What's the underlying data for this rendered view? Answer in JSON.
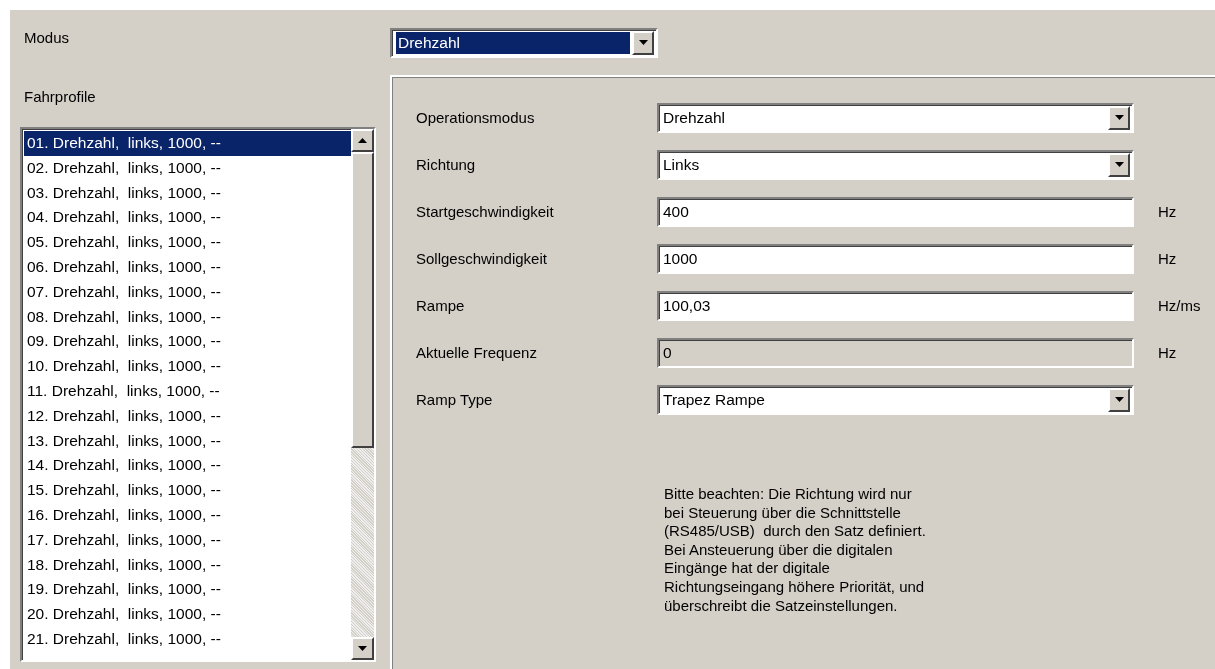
{
  "modus": {
    "label": "Modus",
    "value": "Drehzahl",
    "selected": true
  },
  "profiles": {
    "label": "Fahrprofile",
    "items": [
      {
        "text": "01. Drehzahl,  links, 1000, --",
        "selected": true
      },
      {
        "text": "02. Drehzahl,  links, 1000, --",
        "selected": false
      },
      {
        "text": "03. Drehzahl,  links, 1000, --",
        "selected": false
      },
      {
        "text": "04. Drehzahl,  links, 1000, --",
        "selected": false
      },
      {
        "text": "05. Drehzahl,  links, 1000, --",
        "selected": false
      },
      {
        "text": "06. Drehzahl,  links, 1000, --",
        "selected": false
      },
      {
        "text": "07. Drehzahl,  links, 1000, --",
        "selected": false
      },
      {
        "text": "08. Drehzahl,  links, 1000, --",
        "selected": false
      },
      {
        "text": "09. Drehzahl,  links, 1000, --",
        "selected": false
      },
      {
        "text": "10. Drehzahl,  links, 1000, --",
        "selected": false
      },
      {
        "text": "11. Drehzahl,  links, 1000, --",
        "selected": false
      },
      {
        "text": "12. Drehzahl,  links, 1000, --",
        "selected": false
      },
      {
        "text": "13. Drehzahl,  links, 1000, --",
        "selected": false
      },
      {
        "text": "14. Drehzahl,  links, 1000, --",
        "selected": false
      },
      {
        "text": "15. Drehzahl,  links, 1000, --",
        "selected": false
      },
      {
        "text": "16. Drehzahl,  links, 1000, --",
        "selected": false
      },
      {
        "text": "17. Drehzahl,  links, 1000, --",
        "selected": false
      },
      {
        "text": "18. Drehzahl,  links, 1000, --",
        "selected": false
      },
      {
        "text": "19. Drehzahl,  links, 1000, --",
        "selected": false
      },
      {
        "text": "20. Drehzahl,  links, 1000, --",
        "selected": false
      },
      {
        "text": "21. Drehzahl,  links, 1000, --",
        "selected": false
      }
    ]
  },
  "fields": [
    {
      "kind": "select",
      "label": "Operationsmodus",
      "value": "Drehzahl"
    },
    {
      "kind": "select",
      "label": "Richtung",
      "value": "Links"
    },
    {
      "kind": "text",
      "label": "Startgeschwindigkeit",
      "value": "400",
      "unit": "Hz",
      "disabled": false
    },
    {
      "kind": "text",
      "label": "Sollgeschwindigkeit",
      "value": "1000",
      "unit": "Hz",
      "disabled": false
    },
    {
      "kind": "text",
      "label": "Rampe",
      "value": "100,03",
      "unit": "Hz/ms",
      "disabled": false
    },
    {
      "kind": "text",
      "label": "Aktuelle Frequenz",
      "value": "0",
      "unit": "Hz",
      "disabled": true
    },
    {
      "kind": "select",
      "label": "Ramp Type",
      "value": "Trapez Rampe"
    }
  ],
  "note": "Bitte beachten: Die Richtung wird nur\nbei Steuerung über die Schnittstelle\n(RS485/USB)  durch den Satz definiert.\nBei Ansteuerung über die digitalen\nEingänge hat der digitale\nRichtungseingang höhere Priorität, und\nüberschreibt die Satzeinstellungen."
}
